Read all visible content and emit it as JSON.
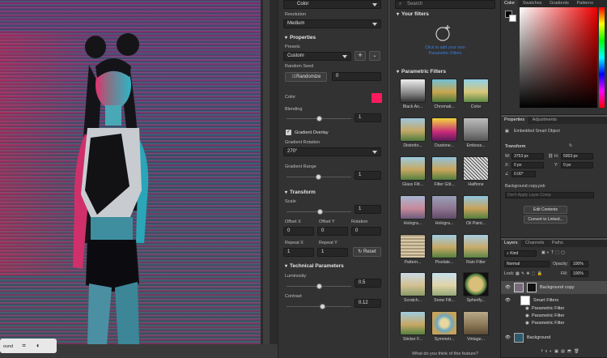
{
  "filter_panel": {
    "color_mode_value": "Color",
    "resolution_label": "Resolution",
    "resolution_value": "Medium",
    "properties_heading": "Properties",
    "presets_label": "Presets",
    "presets_value": "Custom",
    "random_seed_label": "Random Seed",
    "randomize_label": "Randomize",
    "seed_value": "0",
    "color_label": "Color",
    "blending_label": "Blending",
    "blending_value": "1",
    "gradient_overlay_label": "Gradient Overlay",
    "gradient_rotation_label": "Gradient Rotation",
    "gradient_rotation_value": "270°",
    "gradient_range_label": "Gradient Range",
    "gradient_range_value": "1",
    "transform_heading": "Transform",
    "scale_label": "Scale",
    "scale_value": "1",
    "offset_x_label": "Offset X",
    "offset_x_value": "0",
    "offset_y_label": "Offset Y",
    "offset_y_value": "0",
    "rotation_label": "Rotation",
    "rotation_value": "0",
    "repeat_x_label": "Repeat X",
    "repeat_x_value": "1",
    "repeat_y_label": "Repeat Y",
    "repeat_y_value": "1",
    "reset_label": "Reset",
    "technical_heading": "Technical Parameters",
    "luminosity_label": "Luminosity",
    "luminosity_value": "0.5",
    "contrast_label": "Contrast",
    "contrast_value": "0.12",
    "swatch_color": "#ff1a5e"
  },
  "neural_filters": {
    "search_placeholder": "Search",
    "your_filters_heading": "Your filters",
    "add_hint_line1": "Click to add your own",
    "add_hint_line2": "Parametric Filters",
    "parametric_heading": "Parametric Filters",
    "tiles": [
      {
        "label": "Black An..."
      },
      {
        "label": "Chromati..."
      },
      {
        "label": "Color"
      },
      {
        "label": "Distortio..."
      },
      {
        "label": "Duotone..."
      },
      {
        "label": "Emboss..."
      },
      {
        "label": "Glass Filt..."
      },
      {
        "label": "Filter Glit..."
      },
      {
        "label": "Halftone"
      },
      {
        "label": "Hologra..."
      },
      {
        "label": "Hologra..."
      },
      {
        "label": "Oil Paint..."
      },
      {
        "label": "Pattern..."
      },
      {
        "label": "Pixelate..."
      },
      {
        "label": "Rain Filter"
      },
      {
        "label": "Scratch..."
      },
      {
        "label": "Snow Filt..."
      },
      {
        "label": "Spherify..."
      },
      {
        "label": "Sticker F..."
      },
      {
        "label": "Symmetr..."
      },
      {
        "label": "Vintage..."
      }
    ],
    "feedback_text": "What do you think of this feature?"
  },
  "color_panel": {
    "tabs": [
      "Color",
      "Swatches",
      "Gradients",
      "Patterns"
    ]
  },
  "properties_panel": {
    "tabs": [
      "Properties",
      "Adjustments"
    ],
    "object_type": "Embedded Smart Object",
    "transform_label": "Transform",
    "w_label": "W:",
    "w_value": "3753 px",
    "h_label": "H:",
    "h_value": "5003 px",
    "x_label": "X:",
    "x_value": "0 px",
    "y_label": "Y:",
    "y_value": "0 px",
    "angle_value": "0.00°",
    "file_name": "Background copy.psb",
    "layer_comp_placeholder": "Don't Apply Layer Comp",
    "edit_contents_label": "Edit Contents",
    "convert_linked_label": "Convert to Linked..."
  },
  "layers_panel": {
    "tabs": [
      "Layers",
      "Channels",
      "Paths"
    ],
    "kind_label": "Kind",
    "blend_mode": "Normal",
    "opacity_label": "Opacity:",
    "opacity_value": "100%",
    "lock_label": "Lock:",
    "fill_label": "Fill:",
    "fill_value": "100%",
    "layers": [
      {
        "name": "Background copy"
      },
      {
        "name": "Smart Filters"
      },
      {
        "name": "Parametric Filter"
      },
      {
        "name": "Parametric Filter"
      },
      {
        "name": "Parametric Filter"
      },
      {
        "name": "Background"
      }
    ]
  },
  "canvas": {
    "bottom_label": "ound"
  }
}
